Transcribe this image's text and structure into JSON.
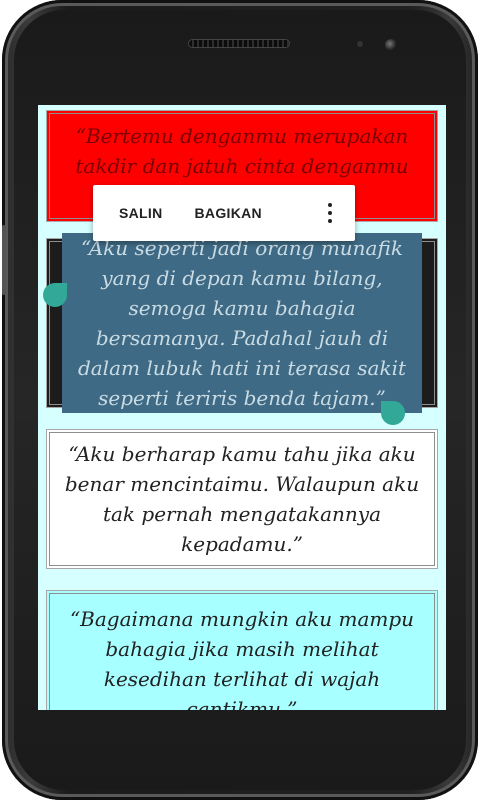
{
  "quotes": {
    "q1": "“Bertemu denganmu merupakan takdir dan jatuh cinta denganmu adalah pilihan.”",
    "q2": "“Aku seperti jadi orang munafik yang di depan kamu bilang, semoga kamu bahagia bersamanya. Padahal jauh di dalam lubuk hati ini terasa sakit seperti teriris benda tajam.”",
    "q3": "“Aku berharap kamu tahu jika aku benar mencintaimu. Walaupun aku tak pernah mengatakannya kepadamu.”",
    "q4": "“Bagaimana mungkin aku mampu bahagia jika masih melihat kesedihan terlihat di wajah cantikmu.”"
  },
  "toolbar": {
    "copy_label": "SALIN",
    "share_label": "BAGIKAN",
    "more_icon": "more-vert-icon"
  },
  "colors": {
    "card1_bg": "#ff0000",
    "card2_bg": "#1c1c1c",
    "card3_bg": "#ffffff",
    "card4_bg": "#a8ffff",
    "selection": "#3f6a85",
    "handle": "#31a898"
  }
}
